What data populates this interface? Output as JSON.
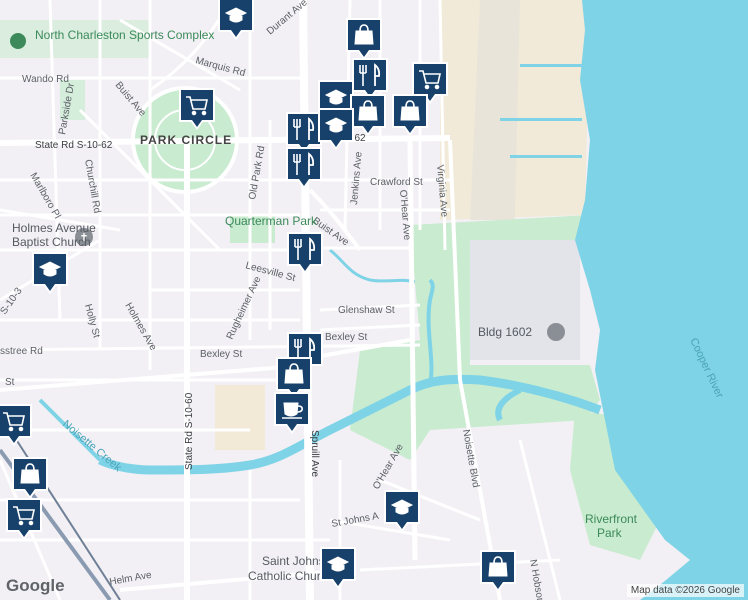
{
  "map": {
    "type": "street map",
    "area_labels": {
      "park_circle": "PARK CIRCLE",
      "north_charleston_sports": "North Charleston Sports Complex",
      "quarterman_park": "Quarterman Park",
      "holmes_avenue_church_1": "Holmes Avenue",
      "holmes_avenue_church_2": "Baptist Church",
      "bldg_1602": "Bldg 1602",
      "riverfront_park_1": "Riverfront",
      "riverfront_park_2": "Park",
      "saint_johns_1": "Saint Johns",
      "saint_johns_2": "Catholic Church"
    },
    "water_labels": {
      "cooper_river": "Cooper River",
      "noisette_creek": "Noisette Creek"
    },
    "streets": {
      "marquis": "Marquis Rd",
      "wando": "Wando Rd",
      "durant": "Durant Ave",
      "buist_top": "Buist Ave",
      "parkside": "Parkside Dr",
      "state_rd_1062_h": "State Rd S-10-62",
      "state_rd_1062_h2": "S-10-62",
      "state_rd_1060_v": "State Rd S-10-60",
      "churchill": "Churchill Rd",
      "marlboro": "Marlboro Pl",
      "old_park": "Old Park Rd",
      "jenkins": "Jenkins Ave",
      "crawford": "Crawford St",
      "virginia": "Virginia Ave",
      "ohear_top": "O'Hear Ave",
      "buist_mid": "Buist Ave",
      "leesville": "Leesville St",
      "glenshaw": "Glenshaw St",
      "rugheimer": "Rugheimer Ave",
      "holmes": "Holmes Ave",
      "holly": "Holly St",
      "bexley_a": "Bexley St",
      "bexley_b": "Bexley St",
      "crosstree": "sstree Rd",
      "st_left": "St",
      "spruill": "Spruill Ave",
      "ohear_bottom": "O'Hear Ave",
      "noisette_blvd": "Noisette Blvd",
      "st_johns": "St Johns A",
      "helm": "Helm Ave",
      "n_hobson": "N Hobson",
      "s103": "S-10-3",
      "left_edge": "ar"
    },
    "pins": [
      {
        "icon": "school-icon"
      },
      {
        "icon": "shopping-bag-icon"
      },
      {
        "icon": "restaurant-icon"
      },
      {
        "icon": "shopping-cart-icon"
      },
      {
        "icon": "school-icon"
      },
      {
        "icon": "shopping-cart-icon"
      },
      {
        "icon": "shopping-bag-icon"
      },
      {
        "icon": "shopping-bag-icon"
      },
      {
        "icon": "restaurant-icon"
      },
      {
        "icon": "school-icon"
      },
      {
        "icon": "restaurant-icon"
      },
      {
        "icon": "restaurant-icon"
      },
      {
        "icon": "school-icon"
      },
      {
        "icon": "restaurant-icon"
      },
      {
        "icon": "shopping-bag-icon"
      },
      {
        "icon": "coffee-icon"
      },
      {
        "icon": "shopping-cart-icon"
      },
      {
        "icon": "shopping-bag-icon"
      },
      {
        "icon": "shopping-cart-icon"
      },
      {
        "icon": "school-icon"
      },
      {
        "icon": "school-icon"
      },
      {
        "icon": "shopping-bag-icon"
      }
    ],
    "colors": {
      "land": "#f2f0f4",
      "water": "#7fd3e6",
      "park": "#c9ebd0",
      "industrial": "#e3e3ea",
      "sand": "#f2ead6",
      "pin": "#17406a",
      "road_major": "#ffffff"
    }
  },
  "footer": {
    "logo": "Google",
    "attribution": "Map data ©2026 Google"
  }
}
